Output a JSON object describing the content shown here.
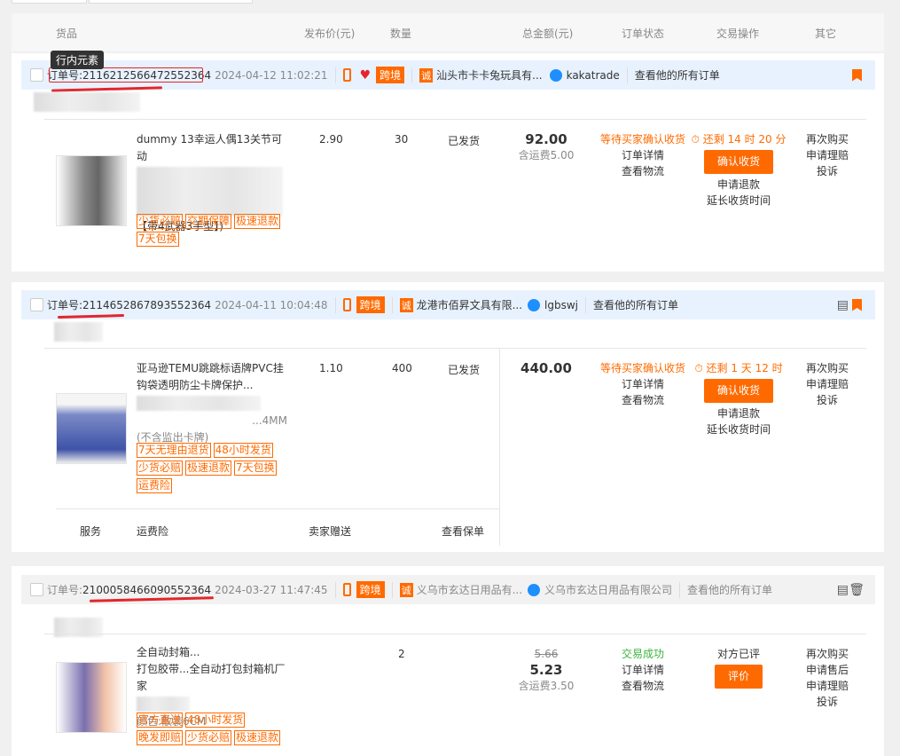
{
  "table_header": {
    "goods": "货品",
    "price": "发布价(元)",
    "qty": "数量",
    "total": "总金额(元)",
    "order_status": "订单状态",
    "trade_ops": "交易操作",
    "other": "其它"
  },
  "tooltip": "行内元素",
  "labels": {
    "order_no": "订单号:",
    "cross_border": "跨境",
    "cheng": "诚",
    "view_all": "查看他的所有订单"
  },
  "orders": [
    {
      "order_id": "2116212566472552364",
      "date": "2024-04-12 11:02:21",
      "shop": "汕头市卡卡兔玩具有...",
      "seller": "kakatrade",
      "title": "dummy 13幸运人偶13关节可动 ... 【带4武器3手型】)",
      "title_l1": "dummy 13幸运人偶13关节可动",
      "title_l2": "【带4武器3手型】)",
      "tags": [
        "少货必赔",
        "交期保障",
        "极速退款",
        "7天包换"
      ],
      "price": "2.90",
      "qty": "30",
      "ship_status": "已发货",
      "total": "92.00",
      "shipping": "含运费5.00",
      "state": "等待买家确认收货",
      "links": [
        "订单详情",
        "查看物流"
      ],
      "countdown": "还剩 14 时 20 分",
      "primary_btn": "确认收货",
      "actions": [
        "申请退款",
        "延长收货时间"
      ],
      "other": [
        "再次购买",
        "申请理赔",
        "投诉"
      ]
    },
    {
      "order_id": "2114652867893552364",
      "date": "2024-04-11 10:04:48",
      "shop": "龙港市佰昇文具有限...",
      "seller": "lgbswj",
      "title_l1": "亚马逊TEMU跳跳标语牌PVC挂",
      "title_l2": "钩袋透明防尘卡牌保护...",
      "title_l3": "(不含监出卡牌)",
      "title_size": "...4MM",
      "tags": [
        "7天无理由退货",
        "48小时发货",
        "少货必赔",
        "极速退款",
        "7天包换",
        "运费险"
      ],
      "price": "1.10",
      "qty": "400",
      "ship_status": "已发货",
      "total": "440.00",
      "state": "等待买家确认收货",
      "links": [
        "订单详情",
        "查看物流"
      ],
      "countdown": "还剩 1 天 12 时",
      "primary_btn": "确认收货",
      "actions": [
        "申请退款",
        "延长收货时间"
      ],
      "other": [
        "再次购买",
        "申请理赔",
        "投诉"
      ],
      "service": {
        "label": "服务",
        "name": "运费险",
        "provider": "卖家赠送",
        "link": "查看保单"
      }
    },
    {
      "order_id": "2100058466090552364",
      "date": "2024-03-27 11:47:45",
      "shop": "义乌市玄达日用品有...",
      "seller": "义乌市玄达日用品有限公司",
      "title_l1": "全自动封箱...",
      "title_l2": "打包胶带...全自动打包封箱机厂家",
      "spec": "颜色:散装6CM",
      "tags": [
        "官方直送",
        "48小时发货",
        "晚发即赔",
        "少货必赔",
        "极速退款"
      ],
      "qty": "2",
      "orig_total": "5.66",
      "total": "5.23",
      "shipping": "含运费3.50",
      "state": "交易成功",
      "links": [
        "订单详情",
        "查看物流"
      ],
      "review_status": "对方已评",
      "primary_btn": "评价",
      "other": [
        "再次购买",
        "申请售后",
        "申请理赔",
        "投诉"
      ]
    }
  ]
}
